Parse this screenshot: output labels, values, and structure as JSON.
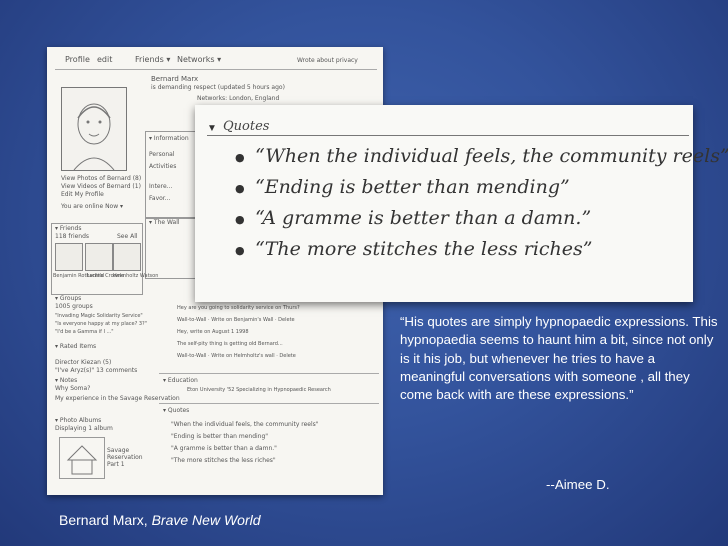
{
  "sketch": {
    "tabs": [
      "Profile",
      "edit",
      "Friends ▾",
      "Networks ▾"
    ],
    "header_right": "Wrote about privacy",
    "name": "Bernard Marx",
    "status": "is demanding respect (updated 5 hours ago)",
    "networks": "Networks: London, England",
    "side_links": [
      "View Photos of Bernard (8)",
      "View Videos of Bernard (1)",
      "Edit My Profile",
      "You are online Now ▾"
    ],
    "info_header": "▾ Information",
    "info_fields": [
      "Personal",
      "Activities",
      "Intere...",
      "Favor..."
    ],
    "wall_header": "▾ The Wall",
    "friends_header": "▾ Friends",
    "friends_count": "118 friends",
    "see_all": "See All",
    "friend_names": [
      "Benjamin Rothschild",
      "Lenina Crowne",
      "Helmholtz Watson"
    ],
    "groups_header": "▾ Groups",
    "groups_count": "1005 groups",
    "groups_items": [
      "\"Invading Magic Solidarity Service\"",
      "\"Is everyone happy at my place? 3?\"",
      "\"I'd be a Gamma if I ...\""
    ],
    "rated_header": "▾ Rated Items",
    "rated_items": [
      "Director Kiezan (5)",
      "\"I've Aryz(s)\" 13 comments"
    ],
    "notes_header": "▾ Notes",
    "notes_items": [
      "Why Soma?",
      "My experience in the Savage Reservation"
    ],
    "albums_header": "▾ Photo Albums",
    "albums_count": "Displaying 1 album",
    "album_name": "Savage Reservation Part 1",
    "wall_posts": [
      "Hey are you going to solidarity service on Thurs?",
      "Wall-to-Wall · Write on Benjamin's Wall · Delete",
      "Hey, write on August 1 1998",
      "The self-pity thing is getting old Bernard...",
      "Wall-to-Wall · Write on Helmholtz's wall · Delete"
    ],
    "education_header": "▾ Education",
    "education_text": "Eton University '52 Specializing in Hypnopaedic Research",
    "quotes_small_header": "▾ Quotes",
    "quotes_small": [
      "\"When the individual feels, the community reels\"",
      "\"Ending is better than mending\"",
      "\"A gramme is better than a damn.\"",
      "\"The more stitches the less riches\""
    ]
  },
  "quotes_panel": {
    "header": "Quotes",
    "items": [
      "“When the individual feels, the community reels”",
      "“Ending is better than mending”",
      "“A gramme is better than a damn.”",
      "“The more stitches the less riches”"
    ]
  },
  "caption": {
    "text": "“His quotes are simply hypnopaedic expressions.  This hypnopaedia seems to haunt him a bit, since not only is it his job, but  whenever he tries to have a meaningful conversations with someone , all they come back with are these expressions.”",
    "attribution": "--Aimee D."
  },
  "title": {
    "name": "Bernard Marx, ",
    "work": "Brave New World"
  },
  "colors": {
    "background": "#33539c",
    "text": "#ffffff"
  }
}
